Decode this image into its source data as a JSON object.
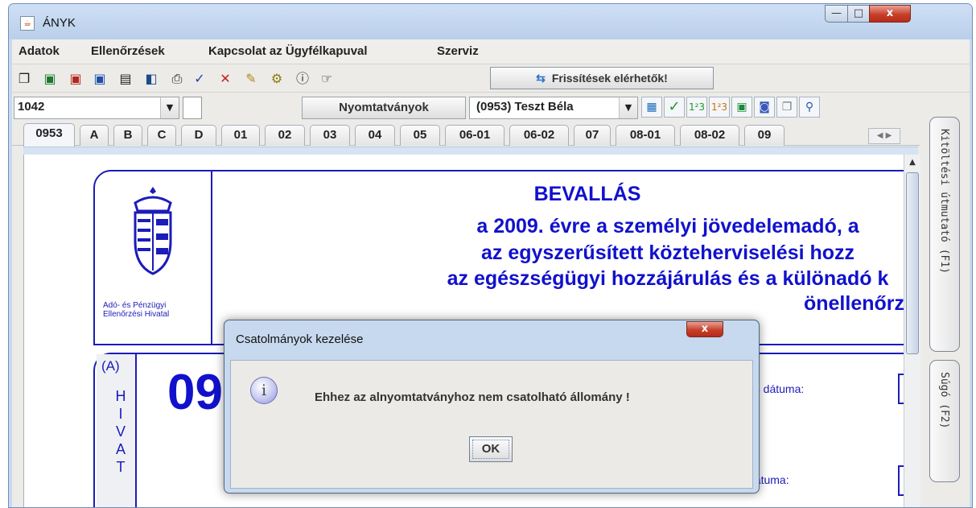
{
  "window": {
    "title": "ÁNYK",
    "controls": {
      "minimize": "—",
      "maximize": "□",
      "close": "x"
    }
  },
  "menu": [
    "Adatok",
    "Ellenőrzések",
    "Kapcsolat az Ügyfélkapuval",
    "Szerviz"
  ],
  "toolbar": {
    "icons": [
      "copy-icon",
      "save-icon",
      "save-close-icon",
      "save-as-icon",
      "print-preview-icon",
      "keys-icon",
      "print-icon",
      "check-icon",
      "delete-icon",
      "edit-icon",
      "settings-icon",
      "info-icon",
      "pointer-icon"
    ],
    "update_label": "Frissítések elérhetők!"
  },
  "row3": {
    "doc_number": "1042",
    "forms_label": "Nyomtatványok",
    "person_value": "(0953) Teszt Béla"
  },
  "tabs": [
    "0953",
    "A",
    "B",
    "C",
    "D",
    "01",
    "02",
    "03",
    "04",
    "05",
    "06-01",
    "06-02",
    "07",
    "08-01",
    "08-02",
    "09"
  ],
  "side_panel": {
    "guide_label": "Kitöltési útmutató (F1)",
    "help_label": "Súgó (F2)"
  },
  "form": {
    "agency_name": "Adó- és Pénzügyi Ellenőrzési Hivatal",
    "title": "BEVALLÁS",
    "subtitle_1": "a 2009. évre a személyi jövedelemadó, a",
    "subtitle_2": "az egyszerűsített közteherviselési hozz",
    "subtitle_3": "az egészségügyi hozzájárulás és a különadó k",
    "subtitle_4": "önellenőrz",
    "section_label": "(A)",
    "section_vertical": [
      "H",
      "I",
      "V",
      "A",
      "T"
    ],
    "big_code": "09",
    "date_label_1": "ás dátuma:",
    "date_label_2": "dátuma:"
  },
  "dialog": {
    "title": "Csatolmányok kezelése",
    "message": "Ehhez az alnyomtatványhoz nem csatolható állomány !",
    "ok_label": "OK",
    "close_label": "x",
    "icon_glyph": "i"
  }
}
